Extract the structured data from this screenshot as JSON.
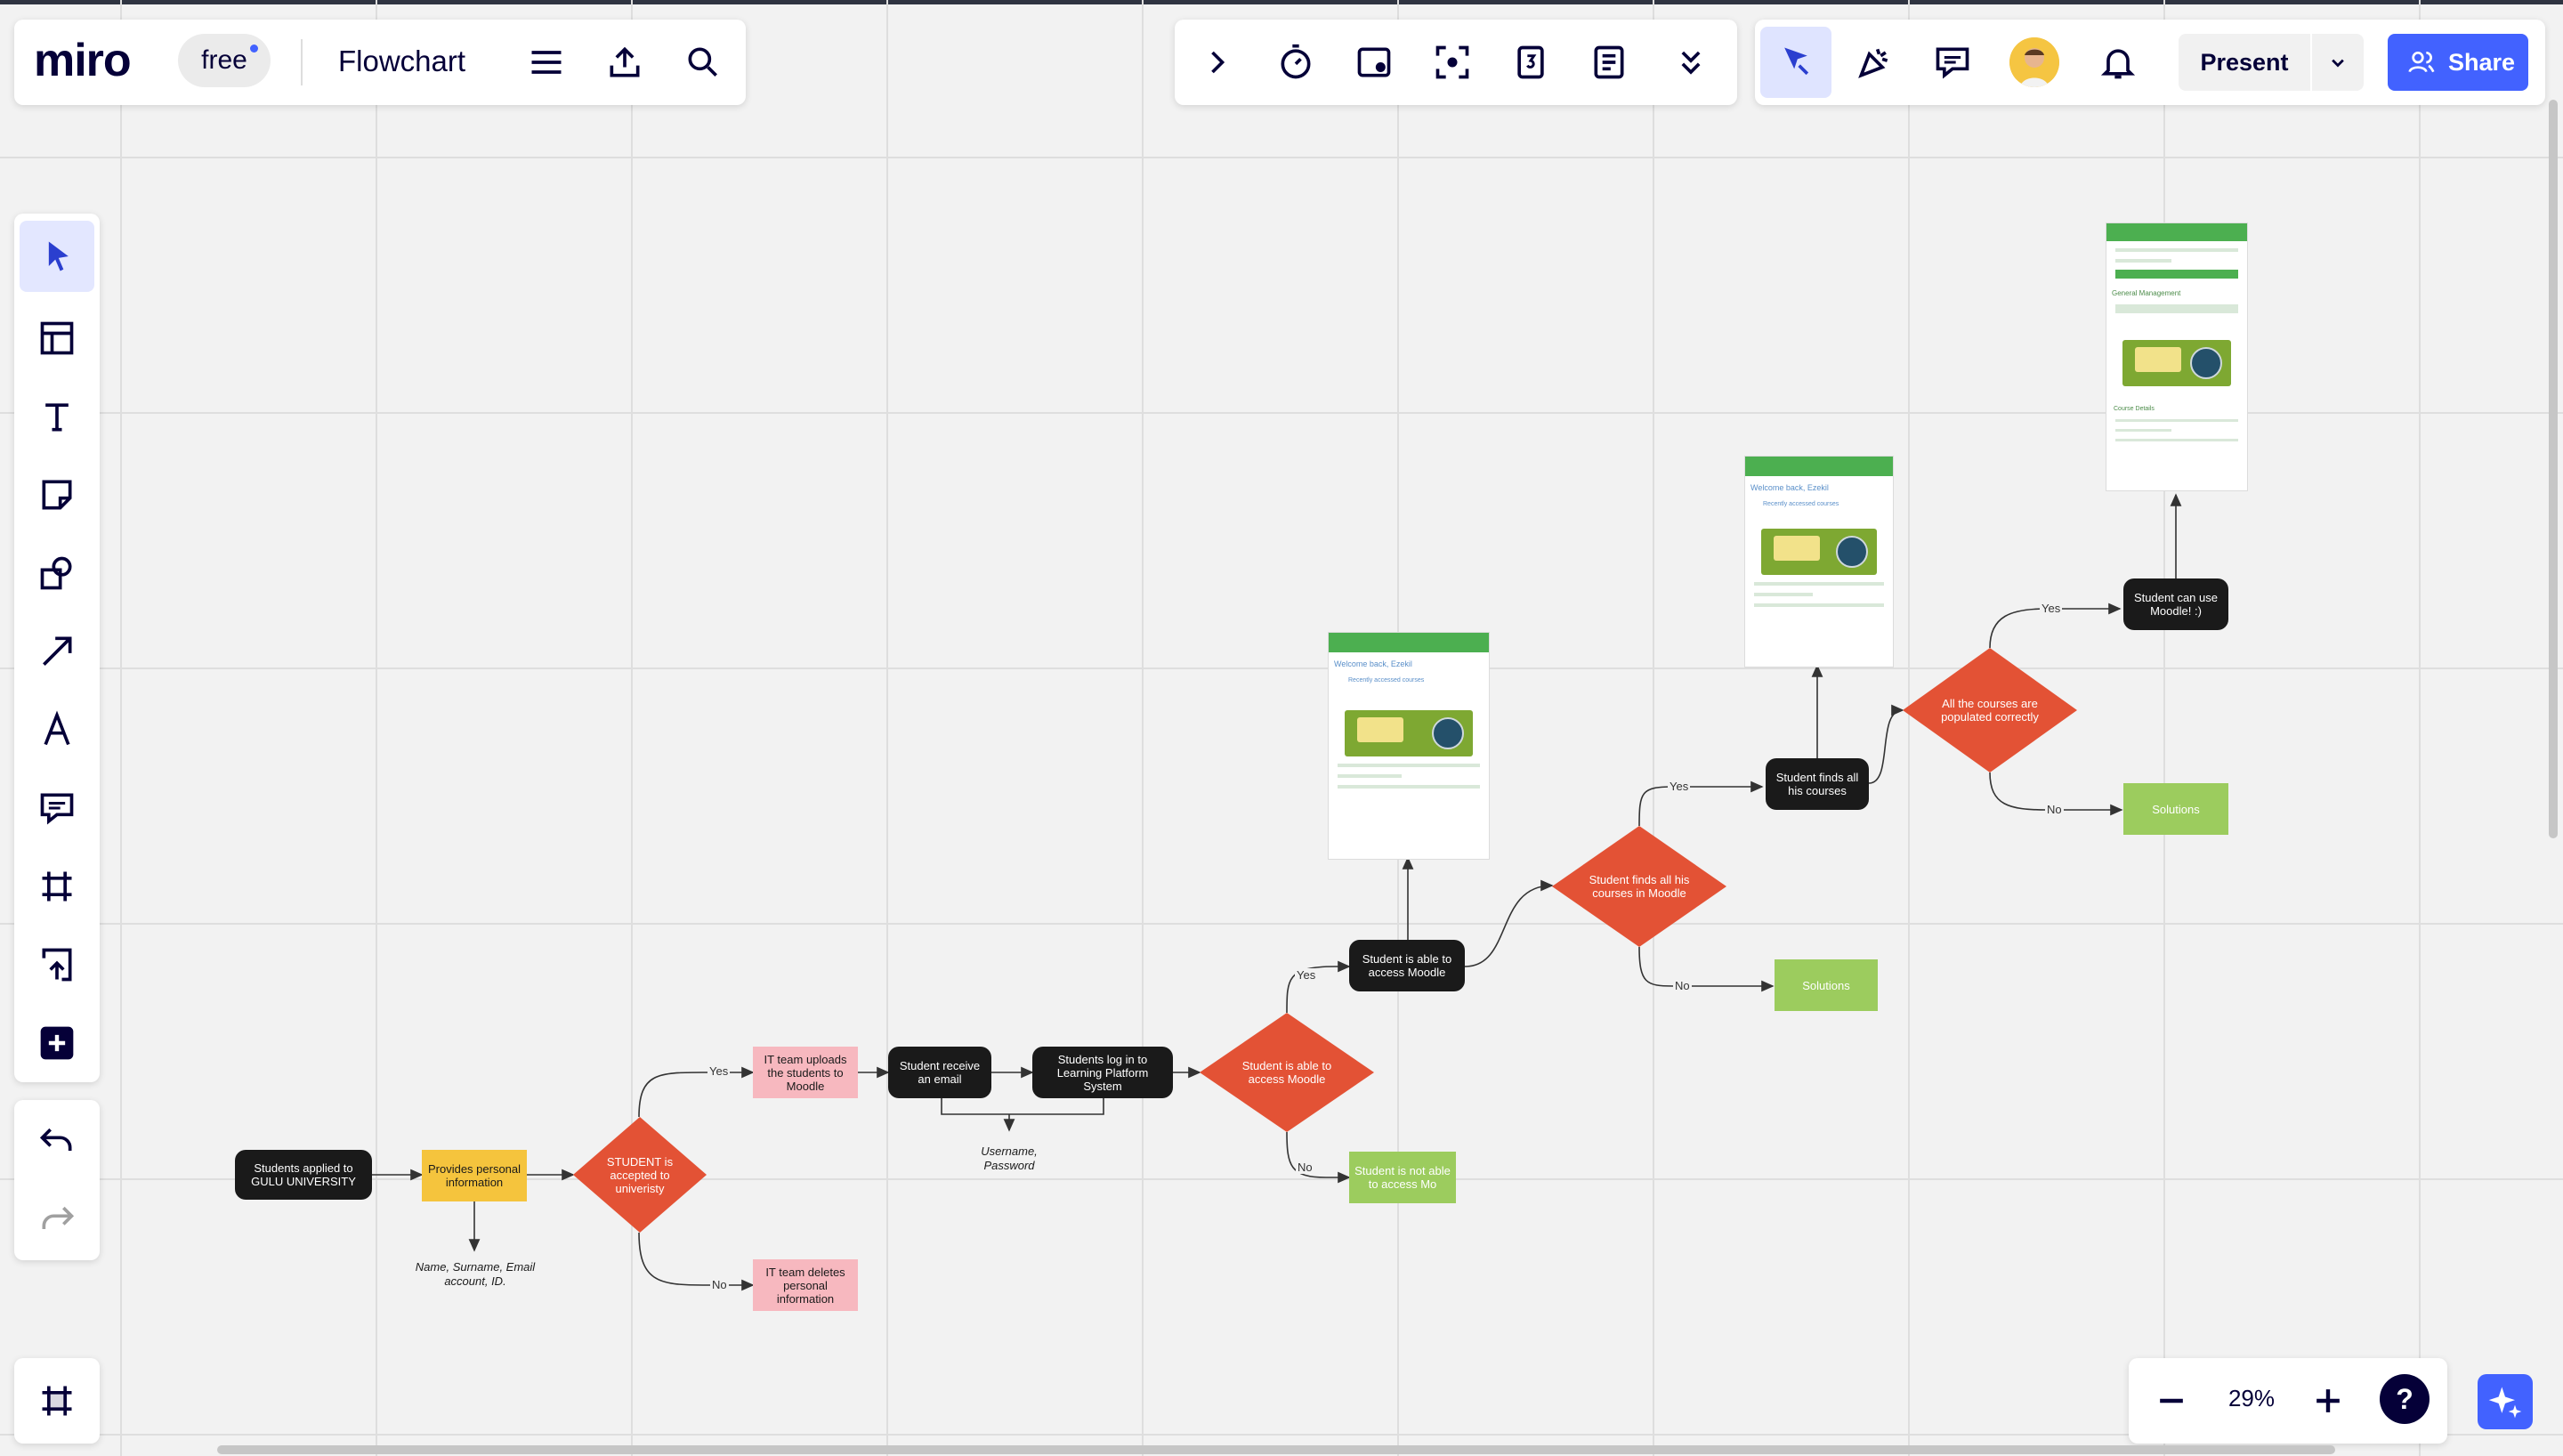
{
  "app": {
    "logo_text": "miro",
    "plan_badge": "free",
    "board_title": "Flowchart"
  },
  "topbar": {
    "menu_icon": "hamburger-menu-icon",
    "upload_icon": "export-upload-icon",
    "search_icon": "search-icon"
  },
  "collab_toolbar": {
    "icons": [
      "chevron-right-icon",
      "timer-icon",
      "card-note-icon",
      "focus-frame-icon",
      "vote-counter-icon",
      "notes-list-icon",
      "double-chevron-down-icon"
    ]
  },
  "right_toolbar": {
    "present_label": "Present",
    "share_label": "Share",
    "accent_color": "#4262ff"
  },
  "left_toolbar": {
    "tools": [
      "select-tool",
      "templates-tool",
      "text-tool",
      "sticky-note-tool",
      "shapes-tool",
      "connection-line-tool",
      "pen-tool",
      "comment-tool",
      "frame-tool",
      "upload-tool",
      "more-apps-tool"
    ]
  },
  "bottom_bar": {
    "zoom_level": "29%",
    "help_label": "?"
  },
  "flowchart": {
    "node_start": "Students applied to GULU UNIVERSITY",
    "node_provides": "Provides personal information",
    "note_info": "Name, Surname, Email account, ID.",
    "decision_accepted": "STUDENT is accepted to univeristy",
    "node_it_uploads": "IT team uploads the students to Moodle",
    "node_it_deletes": "IT team deletes personal information",
    "node_receive_email": "Student receive an email",
    "node_log_in": "Students log in to Learning Platform System",
    "note_credentials": "Username, Password",
    "decision_access": "Student is able to access Moodle",
    "node_not_able": "Student is not able to access Mo",
    "node_able": "Student is able to access Moodle",
    "decision_finds": "Student finds all his courses in Moodle",
    "node_solutions_1": "Solutions",
    "node_finds_all": "Student finds all his courses",
    "decision_populated": "All the courses are populated correctly",
    "node_solutions_2": "Solutions",
    "node_can_use": "Student can use Moodle! :)",
    "label_yes": "Yes",
    "label_no": "No",
    "colors": {
      "decision": "#e35235",
      "process": "#1a1a1a",
      "input": "#f5c43d",
      "it_action": "#f7b8bf",
      "solution": "#9ccc5e"
    }
  },
  "screenshots": {
    "greeting": "Welcome back, Ezekil",
    "section": "Recently accessed courses",
    "course_name": "General Management",
    "course_title": "General Management",
    "course_details": "Course Details"
  }
}
